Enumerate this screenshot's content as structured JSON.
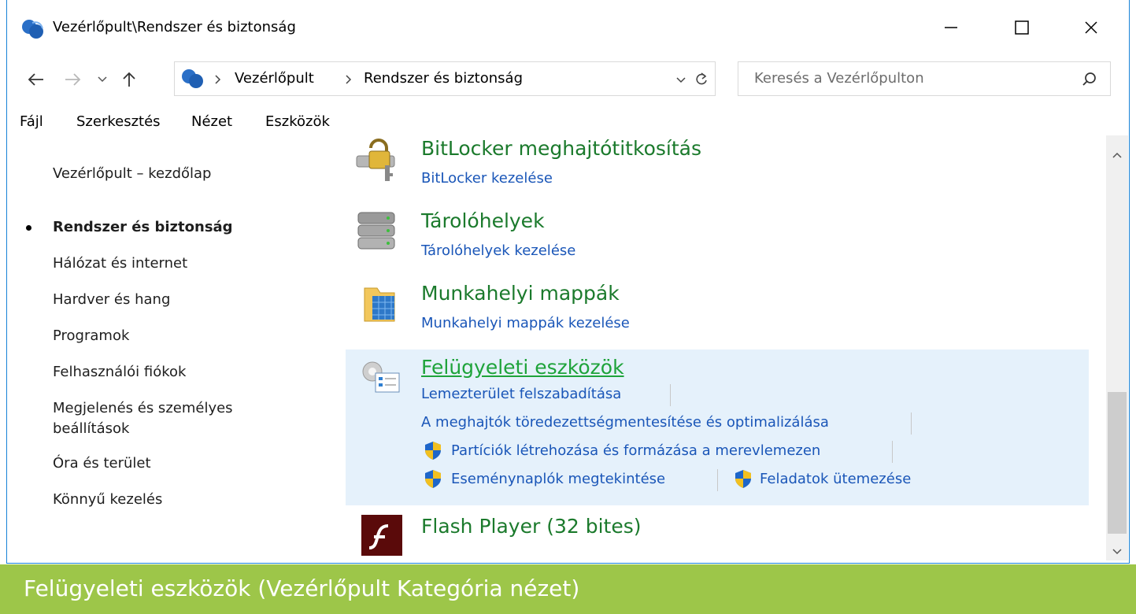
{
  "window": {
    "title": "Vezérlőpult\\Rendszer és biztonság",
    "icon": "control-panel-icon",
    "accent": "#1883d7"
  },
  "address_bar": {
    "crumbs": [
      "Vezérlőpult",
      "Rendszer és biztonság"
    ],
    "search_placeholder": "Keresés a Vezérlőpulton"
  },
  "menu": {
    "items": [
      {
        "label": "Fájl"
      },
      {
        "label": "Szerkesztés"
      },
      {
        "label": "Nézet"
      },
      {
        "label": "Eszközök"
      }
    ]
  },
  "sidebar": {
    "home": "Vezérlőpult – kezdőlap",
    "items": [
      {
        "label": "Rendszer és biztonság",
        "active": true
      },
      {
        "label": "Hálózat és internet"
      },
      {
        "label": "Hardver és hang"
      },
      {
        "label": "Programok"
      },
      {
        "label": "Felhasználói fiókok"
      },
      {
        "label": "Megjelenés és személyes beállítások",
        "line1": "Megjelenés és személyes",
        "line2": "beállítások"
      },
      {
        "label": "Óra és terület"
      },
      {
        "label": "Könnyű kezelés"
      }
    ]
  },
  "main": {
    "items": [
      {
        "title": "BitLocker meghajtótitkosítás",
        "links": [
          "BitLocker kezelése"
        ],
        "icon": "bitlocker-icon"
      },
      {
        "title": "Tárolóhelyek",
        "links": [
          "Tárolóhelyek kezelése"
        ],
        "icon": "storage-spaces-icon"
      },
      {
        "title": "Munkahelyi mappák",
        "links": [
          "Munkahelyi mappák kezelése"
        ],
        "icon": "work-folders-icon"
      },
      {
        "title": "Felügyeleti eszközök",
        "links": [
          "Lemezterület felszabadítása",
          "A meghajtók töredezettségmentesítése és optimalizálása",
          "Partíciók létrehozása és formázása a merevlemezen",
          "Eseménynaplók megtekintése",
          "Feladatok ütemezése"
        ],
        "icon": "admin-tools-icon",
        "selected": true
      },
      {
        "title": "Flash Player (32 bites)",
        "links": [],
        "icon": "flash-player-icon"
      }
    ],
    "title_color": "#1b7a2c",
    "link_color": "#1a56b8",
    "selection_color": "#e5f1fb"
  },
  "caption": {
    "text": "Felügyeleti eszközök (Vezérlőpult Kategória nézet)",
    "background": "#9dc649"
  }
}
